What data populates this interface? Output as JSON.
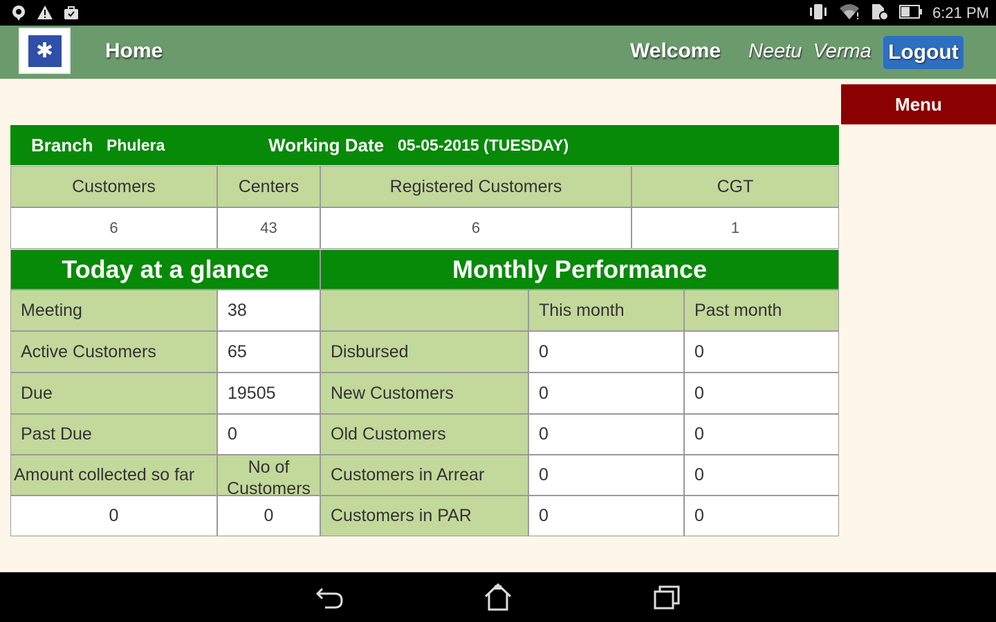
{
  "status_bar": {
    "time": "6:21 PM",
    "left_icons": [
      "location-icon",
      "warning-icon",
      "shopping-bag-icon"
    ],
    "right_icons": [
      "vibrate-icon",
      "wifi-icon",
      "sim-icon",
      "battery-icon"
    ]
  },
  "header": {
    "home_label": "Home",
    "welcome_label": "Welcome",
    "user_name": "Neetu Verma",
    "logout_label": "Logout"
  },
  "menu_label": "Menu",
  "branch_bar": {
    "branch_label": "Branch",
    "branch_value": "Phulera",
    "working_date_label": "Working Date",
    "working_date_value": "05-05-2015 (TUESDAY)"
  },
  "summary": {
    "headers": [
      "Customers",
      "Centers",
      "Registered Customers",
      "CGT"
    ],
    "values": [
      "6",
      "43",
      "6",
      "1"
    ]
  },
  "today": {
    "title": "Today at a glance",
    "rows": [
      {
        "label": "Meeting",
        "value": "38"
      },
      {
        "label": "Active Customers",
        "value": "65"
      },
      {
        "label": "Due",
        "value": "19505"
      },
      {
        "label": "Past Due",
        "value": "0"
      }
    ],
    "collected_label": "Amount collected so far",
    "no_of_customers_label": "No of Customers",
    "collected_value": "0",
    "no_of_customers_value": "0"
  },
  "monthly": {
    "title": "Monthly Performance",
    "col_this": "This month",
    "col_past": "Past month",
    "rows": [
      {
        "label": "Disbursed",
        "this": "0",
        "past": "0"
      },
      {
        "label": "New Customers",
        "this": "0",
        "past": "0"
      },
      {
        "label": "Old Customers",
        "this": "0",
        "past": "0"
      },
      {
        "label": "Customers in Arrear",
        "this": "0",
        "past": "0"
      },
      {
        "label": "Customers in PAR",
        "this": "0",
        "past": "0"
      }
    ]
  },
  "colors": {
    "header_green": "#6b9b6d",
    "section_green": "#078a07",
    "cell_green": "#c3d89b",
    "menu_red": "#8b0000",
    "logout_blue": "#2d6fc0",
    "background": "#fdf6e9"
  }
}
